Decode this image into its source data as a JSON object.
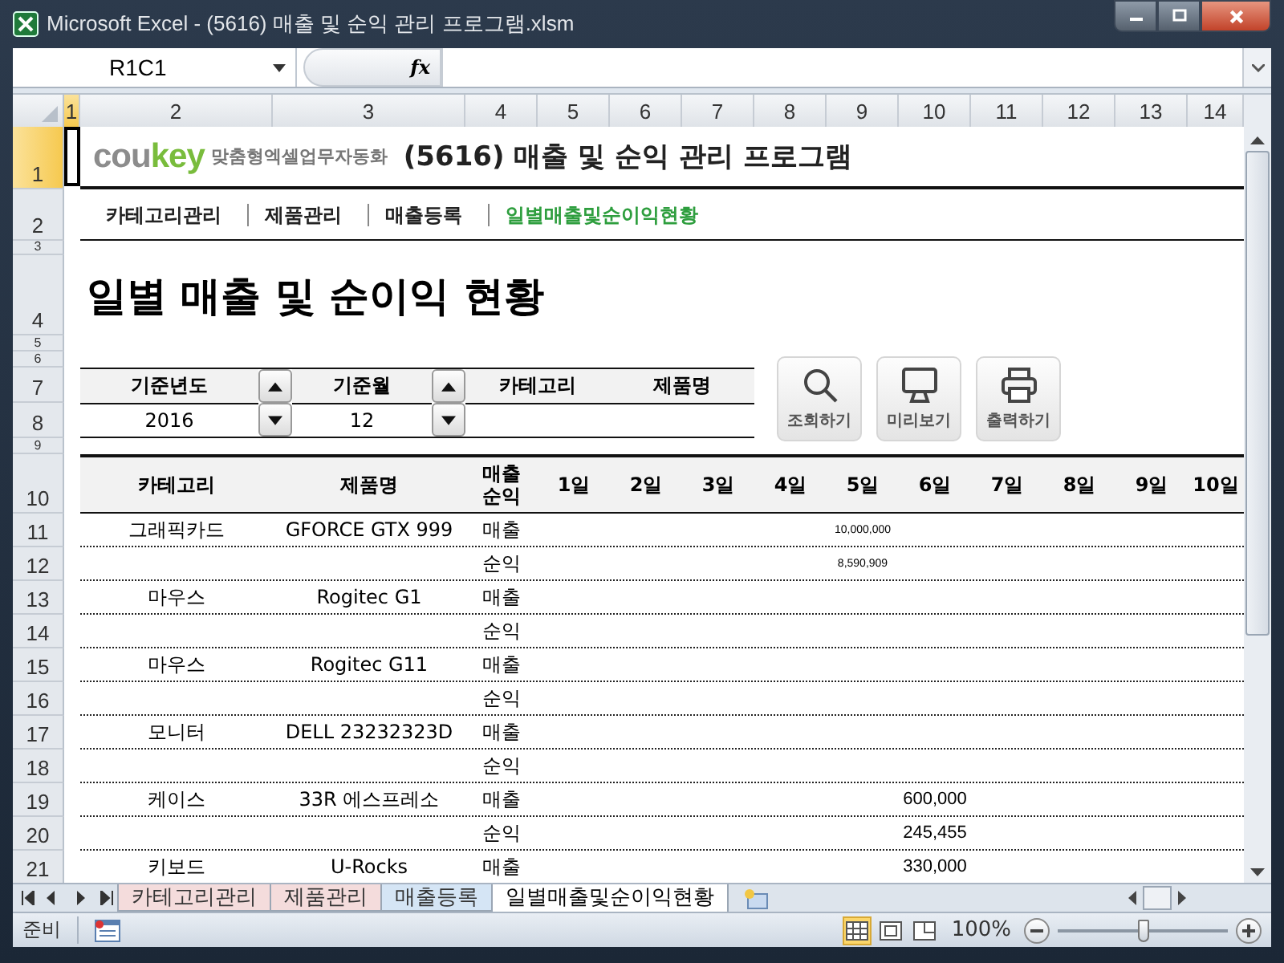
{
  "window": {
    "title": "Microsoft Excel - (5616) 매출 및 순익 관리 프로그램.xlsm"
  },
  "formula_bar": {
    "name_box": "R1C1",
    "fx": "fx"
  },
  "column_headers": [
    {
      "label": "1",
      "selected": true
    },
    {
      "label": "2",
      "selected": false
    },
    {
      "label": "3",
      "selected": false
    },
    {
      "label": "4",
      "selected": false
    },
    {
      "label": "5",
      "selected": false
    },
    {
      "label": "6",
      "selected": false
    },
    {
      "label": "7",
      "selected": false
    },
    {
      "label": "8",
      "selected": false
    },
    {
      "label": "9",
      "selected": false
    },
    {
      "label": "10",
      "selected": false
    },
    {
      "label": "11",
      "selected": false
    },
    {
      "label": "12",
      "selected": false
    },
    {
      "label": "13",
      "selected": false
    },
    {
      "label": "14",
      "selected": false
    }
  ],
  "row_headers": [
    {
      "label": "1",
      "selected": true
    },
    {
      "label": "2",
      "selected": false
    },
    {
      "label": "3",
      "selected": false
    },
    {
      "label": "4",
      "selected": false
    },
    {
      "label": "5",
      "selected": false
    },
    {
      "label": "6",
      "selected": false
    },
    {
      "label": "7",
      "selected": false
    },
    {
      "label": "8",
      "selected": false
    },
    {
      "label": "9",
      "selected": false
    },
    {
      "label": "10",
      "selected": false
    },
    {
      "label": "11",
      "selected": false
    },
    {
      "label": "12",
      "selected": false
    },
    {
      "label": "13",
      "selected": false
    },
    {
      "label": "14",
      "selected": false
    },
    {
      "label": "15",
      "selected": false
    },
    {
      "label": "16",
      "selected": false
    },
    {
      "label": "17",
      "selected": false
    },
    {
      "label": "18",
      "selected": false
    },
    {
      "label": "19",
      "selected": false
    },
    {
      "label": "20",
      "selected": false
    },
    {
      "label": "21",
      "selected": false
    }
  ],
  "logo": {
    "parts": [
      {
        "text": "cou",
        "color": "#8c8c8c"
      },
      {
        "text": "key",
        "color": "#79bc3c"
      }
    ],
    "tagline": "맞춤형엑셀업무자동화"
  },
  "program_title": "(5616) 매출 및 순익 관리 프로그램",
  "nav": [
    {
      "label": "카테고리관리",
      "selected": false
    },
    {
      "label": "제품관리",
      "selected": false
    },
    {
      "label": "매출등록",
      "selected": false
    },
    {
      "label": "일별매출및순이익현황",
      "selected": true
    }
  ],
  "heading": "일별 매출 및 순이익 현황",
  "filters": [
    {
      "label": "기준년도",
      "value": "2016",
      "kind": "spinner"
    },
    {
      "label": "기준월",
      "value": "12",
      "kind": "spinner"
    },
    {
      "label": "카테고리",
      "kind": "text"
    },
    {
      "label": "제품명",
      "kind": "text"
    }
  ],
  "actions": [
    {
      "label": "조회하기",
      "kind": "search"
    },
    {
      "label": "미리보기",
      "kind": "monitor"
    },
    {
      "label": "출력하기",
      "kind": "printer"
    }
  ],
  "table": {
    "columns": [
      "카테고리",
      "제품명",
      "매출 순익",
      "1일",
      "2일",
      "3일",
      "4일",
      "5일",
      "6일",
      "7일",
      "8일",
      "9일",
      "10일"
    ],
    "rows": [
      {
        "category": "그래픽카드",
        "product": "GFORCE GTX 999",
        "measure": "매출",
        "days": {
          "5": "10,000,000"
        }
      },
      {
        "measure": "순익",
        "days": {
          "5": "8,590,909"
        }
      },
      {
        "category": "마우스",
        "product": "Rogitec G1",
        "measure": "매출"
      },
      {
        "measure": "순익"
      },
      {
        "category": "마우스",
        "product": "Rogitec G11",
        "measure": "매출"
      },
      {
        "measure": "순익"
      },
      {
        "category": "모니터",
        "product": "DELL 23232323D",
        "measure": "매출"
      },
      {
        "measure": "순익"
      },
      {
        "category": "케이스",
        "product": "33R 에스프레소",
        "measure": "매출",
        "days": {
          "6": "600,000"
        }
      },
      {
        "measure": "순익",
        "days": {
          "6": "245,455"
        }
      },
      {
        "category": "키보드",
        "product": "U-Rocks",
        "measure": "매출",
        "days": {
          "6": "330,000"
        }
      }
    ]
  },
  "sheet_tabs": [
    {
      "label": "카테고리관리",
      "selected": false,
      "color": "#f4dcdc"
    },
    {
      "label": "제품관리",
      "selected": false,
      "color": "#f4dcdc"
    },
    {
      "label": "매출등록",
      "selected": false,
      "color": "#d5e5f5"
    },
    {
      "label": "일별매출및순이익현황",
      "selected": true,
      "color": "#ffffff"
    }
  ],
  "status_bar": {
    "status": "준비",
    "zoom": "100%",
    "views": [
      {
        "kind": "normal",
        "selected": true
      },
      {
        "kind": "layout",
        "selected": false
      },
      {
        "kind": "pagebreak",
        "selected": false
      }
    ],
    "zoom_slider": {
      "level": 0.5
    }
  }
}
